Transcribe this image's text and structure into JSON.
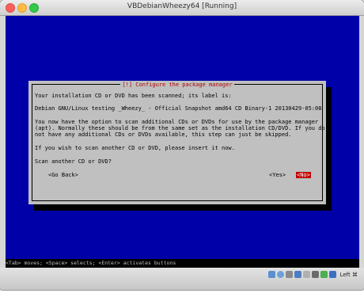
{
  "window": {
    "title": "VBDebianWheezy64 [Running]"
  },
  "dialog": {
    "title": "[!] Configure the package manager",
    "lines": [
      "Your installation CD or DVD has been scanned; its label is:",
      "Debian GNU/Linux testing _Wheezy_ - Official Snapshot amd64 CD Binary-1 20130429-05:08",
      "You now have the option to scan additional CDs or DVDs for use by the package manager",
      "(apt). Normally these should be from the same set as the installation CD/DVD. If you do",
      "not have any additional CDs or DVDs available, this step can just be skipped.",
      "If you wish to scan another CD or DVD, please insert it now.",
      "Scan another CD or DVD?"
    ],
    "buttons": {
      "go_back": "<Go Back>",
      "yes": "<Yes>",
      "no": "<No>"
    }
  },
  "footer": {
    "help": "<Tab> moves; <Space> selects; <Enter> activates buttons"
  },
  "statusbar": {
    "icons": [
      "hdd-icon",
      "cd-icon",
      "usb-icon",
      "network-icon",
      "shared-folder-icon",
      "display-icon",
      "capture-icon",
      "mouse-integration-icon"
    ],
    "host_key": "Left ⌘"
  }
}
